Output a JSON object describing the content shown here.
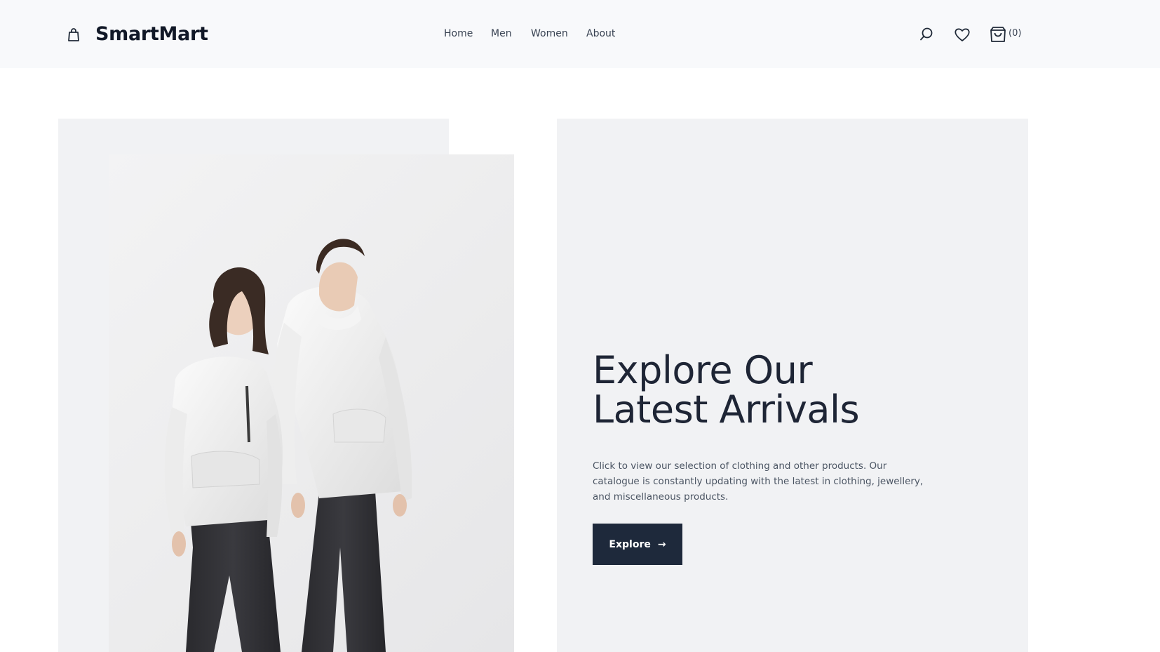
{
  "brand": {
    "name": "SmartMart",
    "icon": "shopping-bag-icon"
  },
  "nav": {
    "items": [
      {
        "label": "Home"
      },
      {
        "label": "Men"
      },
      {
        "label": "Women"
      },
      {
        "label": "About"
      }
    ]
  },
  "header_actions": {
    "search_icon": "search-icon",
    "wishlist_icon": "heart-icon",
    "cart_icon": "cart-icon",
    "cart_count": "(0)"
  },
  "hero": {
    "title_line1": "Explore Our",
    "title_line2": "Latest Arrivals",
    "description": "Click to view our selection of clothing and other products. Our catalogue is constantly updating with the latest in clothing, jewellery, and miscellaneous products.",
    "button_label": "Explore",
    "button_arrow": "→",
    "image_alt": "Two models wearing white hoodies and dark jeans"
  },
  "colors": {
    "header_bg": "#f8f9fb",
    "panel_bg": "#f1f2f4",
    "heading": "#1e2535",
    "button_bg": "#1e293b",
    "button_text": "#ffffff"
  }
}
